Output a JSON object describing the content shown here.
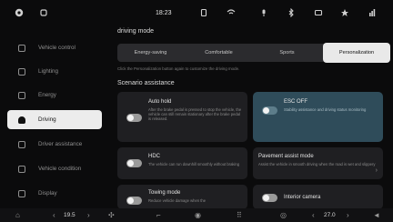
{
  "status_bar": {
    "time": "18:23",
    "icons": [
      "circle-dot-icon",
      "phone-icon",
      "tablet-icon",
      "wifi-icon",
      "mic-icon",
      "bluetooth-icon",
      "settings-icon",
      "star-icon",
      "chart-icon"
    ]
  },
  "sidebar": {
    "items": [
      {
        "label": "Vehicle control",
        "icon": "car-icon",
        "active": false
      },
      {
        "label": "Lighting",
        "icon": "light-icon",
        "active": false
      },
      {
        "label": "Energy",
        "icon": "battery-icon",
        "active": false
      },
      {
        "label": "Driving",
        "icon": "steering-icon",
        "active": true
      },
      {
        "label": "Driver assistance",
        "icon": "assist-icon",
        "active": false
      },
      {
        "label": "Vehicle condition",
        "icon": "diagnostics-icon",
        "active": false
      },
      {
        "label": "Display",
        "icon": "display-icon",
        "active": false
      }
    ]
  },
  "driving_mode": {
    "title": "driving mode",
    "modes": [
      "Energy-saving",
      "Comfortable",
      "Sports",
      "Personalization"
    ],
    "selected": "Personalization",
    "hint": "Click the Personalization button again to customize the driving mode."
  },
  "scenario": {
    "title": "Scenario assistance",
    "cards": {
      "auto_hold": {
        "title": "Auto hold",
        "desc": "After the brake pedal is pressed to stop the vehicle, the vehicle can still remain stationary after the brake pedal is released."
      },
      "esc_off": {
        "title": "ESC OFF",
        "desc": "Stability assistance and driving status monitoring"
      },
      "hdc": {
        "title": "HDC",
        "desc": "The vehicle can run downhill smoothly without braking"
      },
      "pavement": {
        "title": "Pavement assist mode",
        "desc": "Assist the vehicle in smooth driving when the road is wet and slippery"
      },
      "towing": {
        "title": "Towing mode",
        "desc": "Reduce vehicle damage when the"
      },
      "camera": {
        "title": "Interior camera",
        "desc": ""
      }
    }
  },
  "bottom_bar": {
    "temp_left": "19.5",
    "temp_right": "27.0",
    "icons": [
      "home-icon",
      "chevron-left-icon",
      "chevron-right-icon",
      "fan-icon",
      "seat-icon",
      "steering-heat-icon",
      "apps-icon",
      "ac-icon",
      "volume-icon"
    ]
  }
}
